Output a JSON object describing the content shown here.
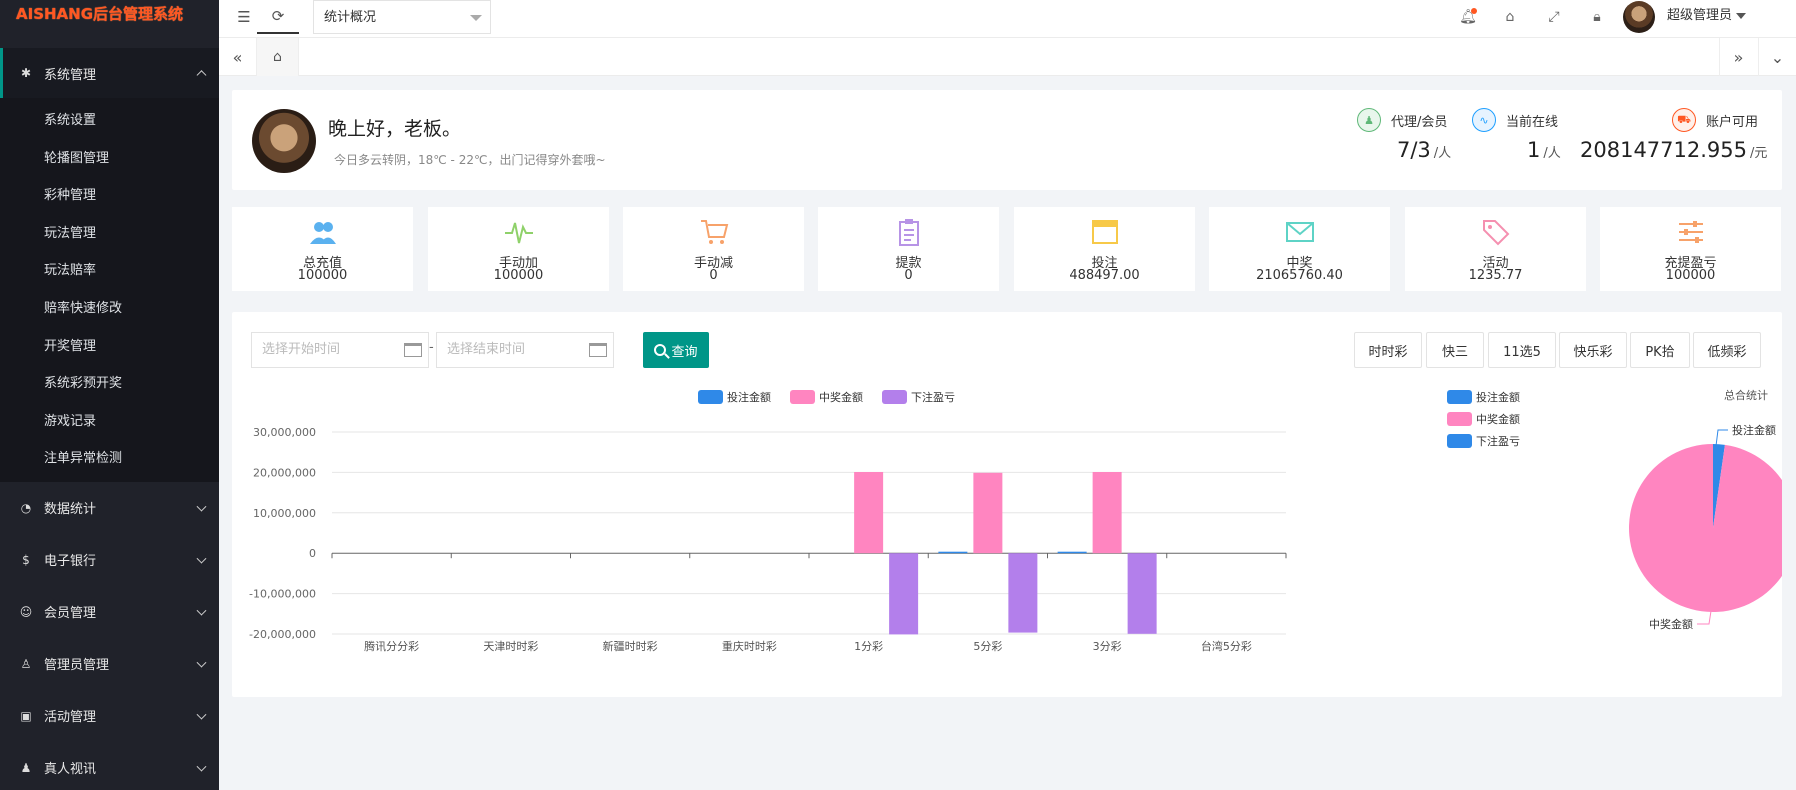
{
  "app": {
    "logo_text": "AISHANG后台管理系统"
  },
  "sidebar": {
    "active_group": {
      "label": "系统管理",
      "icon": "gear-icon"
    },
    "subitems": [
      "系统设置",
      "轮播图管理",
      "彩种管理",
      "玩法管理",
      "玩法赔率",
      "赔率快速修改",
      "开奖管理",
      "系统彩预开奖",
      "游戏记录",
      "注单异常检测"
    ],
    "groups": [
      {
        "label": "数据统计",
        "icon": "dashboard-icon"
      },
      {
        "label": "电子银行",
        "icon": "money-icon"
      },
      {
        "label": "会员管理",
        "icon": "member-icon"
      },
      {
        "label": "管理员管理",
        "icon": "user-icon"
      },
      {
        "label": "活动管理",
        "icon": "gift-icon"
      },
      {
        "label": "真人视讯",
        "icon": "users-icon"
      }
    ]
  },
  "topbar": {
    "page_select": "统计概况",
    "user_name": "超级管理员"
  },
  "welcome": {
    "greeting": "晚上好，老板。",
    "weather": "今日多云转阴，18℃ - 22℃，出门记得穿外套哦~"
  },
  "stats": [
    {
      "label": "代理/会员",
      "value": "7/3",
      "unit": "/人",
      "color": "#5fb878"
    },
    {
      "label": "当前在线",
      "value": "1",
      "unit": "/人",
      "color": "#1e9fff"
    },
    {
      "label": "账户可用",
      "value": "208147712.955",
      "unit": "/元",
      "color": "#ff5722"
    }
  ],
  "tiles": [
    {
      "label": "总充值",
      "value": "100000",
      "icon": "users-icon",
      "color": "#5ab1ef"
    },
    {
      "label": "手动加",
      "value": "100000",
      "icon": "pulse-icon",
      "color": "#8fd16a"
    },
    {
      "label": "手动减",
      "value": "0",
      "icon": "cart-icon",
      "color": "#f7a26a"
    },
    {
      "label": "提款",
      "value": "0",
      "icon": "clipboard-icon",
      "color": "#b794e6"
    },
    {
      "label": "投注",
      "value": "488497.00",
      "icon": "window-icon",
      "color": "#f7c948"
    },
    {
      "label": "中奖",
      "value": "21065760.40",
      "icon": "mail-icon",
      "color": "#5ed3c6"
    },
    {
      "label": "活动",
      "value": "1235.77",
      "icon": "tag-icon",
      "color": "#f590b0"
    },
    {
      "label": "充提盈亏",
      "value": "100000",
      "icon": "sliders-icon",
      "color": "#f7a26a"
    }
  ],
  "filters": {
    "start_placeholder": "选择开始时间",
    "end_placeholder": "选择结束时间",
    "separator": "-",
    "query_label": "查询",
    "buttons": [
      "时时彩",
      "快三",
      "11选5",
      "快乐彩",
      "PK拾",
      "低频彩"
    ]
  },
  "chart_data": [
    {
      "type": "bar",
      "categories": [
        "腾讯分分彩",
        "天津时时彩",
        "新疆时时彩",
        "重庆时时彩",
        "1分彩",
        "5分彩",
        "3分彩",
        "台湾5分彩"
      ],
      "series": [
        {
          "name": "投注金额",
          "color": "#2f89e8",
          "values": [
            0,
            0,
            0,
            0,
            0,
            250000,
            150000,
            0
          ]
        },
        {
          "name": "中奖金额",
          "color": "#ff85c0",
          "values": [
            0,
            0,
            0,
            0,
            20100000,
            19900000,
            20100000,
            0
          ]
        },
        {
          "name": "下注盈亏",
          "color": "#b37feb",
          "values": [
            0,
            0,
            0,
            0,
            -20100000,
            -19650000,
            -19950000,
            0
          ]
        }
      ],
      "ylim": [
        -20000000,
        30000000
      ],
      "yticks": [
        "30,000,000",
        "20,000,000",
        "10,000,000",
        "0",
        "-10,000,000",
        "-20,000,000"
      ],
      "legend": "top-center",
      "grid": true
    },
    {
      "type": "pie",
      "title": "总合统计",
      "legend": [
        {
          "name": "投注金额",
          "color": "#2f89e8"
        },
        {
          "name": "中奖金额",
          "color": "#ff85c0"
        },
        {
          "name": "下注盈亏",
          "color": "#2f89e8"
        }
      ],
      "slices": [
        {
          "name": "投注金额",
          "value": 488497.0,
          "color": "#2f89e8"
        },
        {
          "name": "中奖金额",
          "value": 21065760.4,
          "color": "#ff85c0"
        }
      ]
    }
  ]
}
